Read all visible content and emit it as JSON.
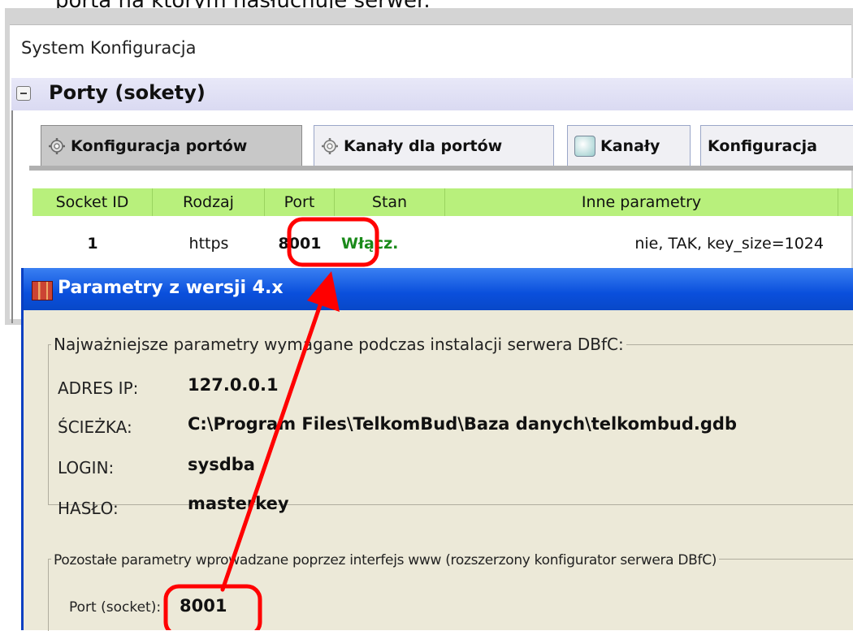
{
  "caption": "porta na którym nasłuchuje serwer.",
  "main": {
    "title": "System Konfiguracja",
    "section_title": "Porty (sokety)",
    "tabs": [
      {
        "label": "Konfiguracja portów",
        "icon": "gear-icon",
        "active": true
      },
      {
        "label": "Kanały dla portów",
        "icon": "gear-icon",
        "active": false
      },
      {
        "label": "Kanały",
        "icon": "channel-icon",
        "active": false
      },
      {
        "label": "Konfiguracja",
        "icon": "",
        "active": false
      }
    ],
    "table": {
      "headers": [
        "Socket ID",
        "Rodzaj",
        "Port",
        "Stan",
        "Inne parametry"
      ],
      "rows": [
        {
          "socket_id": "1",
          "type": "https",
          "port": "8001",
          "state": "Włącz.",
          "params": "nie, TAK, key_size=1024"
        }
      ]
    }
  },
  "dialog": {
    "title": "Parametry z wersji 4.x",
    "group1_legend": "Najważniejsze parametry wymagane podczas instalacji serwera DBfC:",
    "fields": [
      {
        "label": "ADRES IP:",
        "value": "127.0.0.1"
      },
      {
        "label": "ŚCIEŻKA:",
        "value": "C:\\Program Files\\TelkomBud\\Baza danych\\telkombud.gdb"
      },
      {
        "label": "LOGIN:",
        "value": "sysdba"
      },
      {
        "label": "HASŁO:",
        "value": "masterkey"
      }
    ],
    "group2_legend": "Pozostałe parametry wprowadzane poprzez interfejs www (rozszerzony konfigurator serwera DBfC)",
    "port_label": "Port (socket):",
    "port_value": "8001"
  },
  "colors": {
    "table_header": "#b8f07c",
    "state_on": "#1a8a1a",
    "dialog_titlebar": "#0a4fdc",
    "highlight": "#ff0000"
  }
}
